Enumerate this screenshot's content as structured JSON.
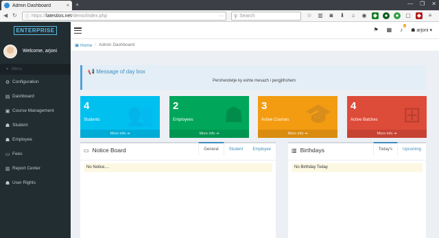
{
  "browser": {
    "tab_title": "Admin Dashboard",
    "tab_close": "×",
    "new_tab": "+",
    "url_prefix": "https://",
    "url_host": "latestios.net",
    "url_path": "/demo/index.php",
    "url_more": "···",
    "search_placeholder": "Search",
    "window_controls": [
      "—",
      "❐",
      "✕"
    ]
  },
  "sidebar": {
    "brand": "ENTERPRISE",
    "welcome": "Welcome, arjoni",
    "menu_header": "Menu",
    "items": [
      {
        "label": "Configuration",
        "icon": "⚙"
      },
      {
        "label": "Dashboard",
        "icon": "▤"
      },
      {
        "label": "Course Management",
        "icon": "▣"
      },
      {
        "label": "Student",
        "icon": "☗"
      },
      {
        "label": "Employee",
        "icon": "☗"
      },
      {
        "label": "Fees",
        "icon": "▭"
      },
      {
        "label": "Report Center",
        "icon": "▥"
      },
      {
        "label": "User Rights",
        "icon": "☗"
      }
    ]
  },
  "header": {
    "notif_count": "0",
    "user": "arjoni ▾"
  },
  "breadcrumb": {
    "home": "Home",
    "current": "Admin Dashboard"
  },
  "message": {
    "title": "Message of day box",
    "text": "Pershendetje ky eshte mesazh i pergjithshem"
  },
  "stats": [
    {
      "value": "4",
      "label": "Students",
      "more": "More info ➔"
    },
    {
      "value": "2",
      "label": "Employees",
      "more": "More info ➔"
    },
    {
      "value": "3",
      "label": "Active Courses",
      "more": "More info ➔"
    },
    {
      "value": "4",
      "label": "Active Batches",
      "more": "More info ➔"
    }
  ],
  "notice_board": {
    "title": "Notice Board",
    "tabs": [
      "General",
      "Student",
      "Employee"
    ],
    "content": "No Notice...."
  },
  "birthdays": {
    "title": "Birthdays",
    "tabs": [
      "Today's",
      "Upcoming"
    ],
    "content": "No Birthday Today"
  },
  "colors": {
    "info": "#00c0ef",
    "success": "#00a65a",
    "warning": "#f39c12",
    "danger": "#dd4b39",
    "sidebar": "#222d32"
  }
}
